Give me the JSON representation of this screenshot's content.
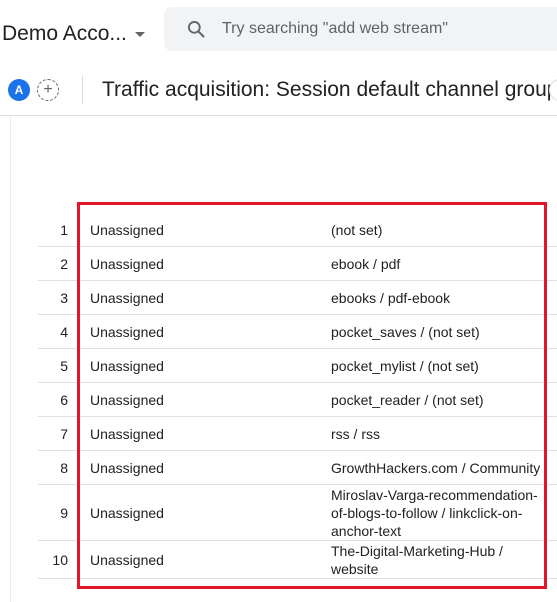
{
  "header": {
    "account_name": "Demo Acco...",
    "search_placeholder": "Try searching \"add web stream\""
  },
  "report": {
    "avatar_letter": "A",
    "add_comparison": "+",
    "title": "Traffic acquisition: Session default channel group"
  },
  "table": {
    "rows": [
      {
        "index": "1",
        "channel": "Unassigned",
        "source_medium": "(not set)"
      },
      {
        "index": "2",
        "channel": "Unassigned",
        "source_medium": "ebook / pdf"
      },
      {
        "index": "3",
        "channel": "Unassigned",
        "source_medium": "ebooks / pdf-ebook"
      },
      {
        "index": "4",
        "channel": "Unassigned",
        "source_medium": "pocket_saves / (not set)"
      },
      {
        "index": "5",
        "channel": "Unassigned",
        "source_medium": "pocket_mylist / (not set)"
      },
      {
        "index": "6",
        "channel": "Unassigned",
        "source_medium": "pocket_reader / (not set)"
      },
      {
        "index": "7",
        "channel": "Unassigned",
        "source_medium": "rss / rss"
      },
      {
        "index": "8",
        "channel": "Unassigned",
        "source_medium": "GrowthHackers.com / Community"
      },
      {
        "index": "9",
        "channel": "Unassigned",
        "source_medium": "Miroslav-Varga-recommendation-of-blogs-to-follow / linkclick-on-anchor-text"
      },
      {
        "index": "10",
        "channel": "Unassigned",
        "source_medium": "The-Digital-Marketing-Hub / website"
      }
    ]
  },
  "colors": {
    "highlight": "#e4142b",
    "avatar": "#1a73e8",
    "search_bg": "#f1f3f4"
  },
  "icons": {
    "search": "search-icon",
    "caret": "caret-down-icon"
  }
}
